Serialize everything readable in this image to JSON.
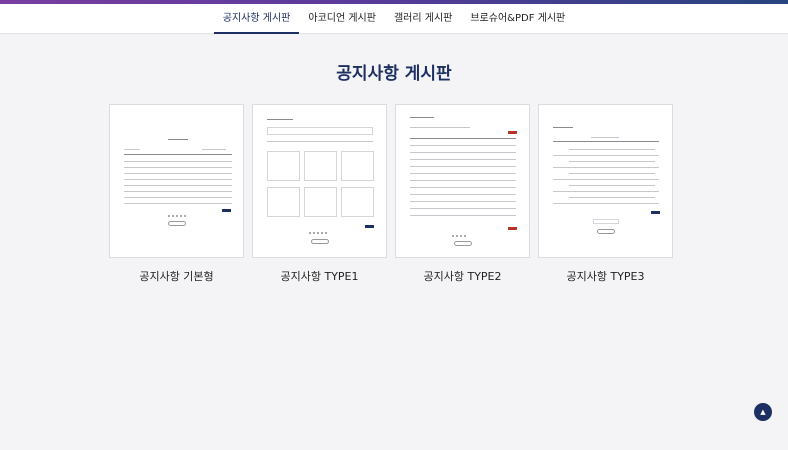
{
  "tabs": [
    {
      "label": "공지사항 게시판",
      "active": true
    },
    {
      "label": "아코디언 게시판",
      "active": false
    },
    {
      "label": "갤러리 게시판",
      "active": false
    },
    {
      "label": "브로슈어&PDF 게시판",
      "active": false
    }
  ],
  "page_title": "공지사항 게시판",
  "cards": [
    {
      "label": "공지사항 기본형"
    },
    {
      "label": "공지사항 TYPE1"
    },
    {
      "label": "공지사항 TYPE2"
    },
    {
      "label": "공지사항 TYPE3"
    }
  ],
  "colors": {
    "accent": "#1d2f63",
    "brand_red": "#b8322a",
    "background": "#f4f4f6"
  },
  "icons": {
    "top_button": "arrow-up-icon"
  }
}
